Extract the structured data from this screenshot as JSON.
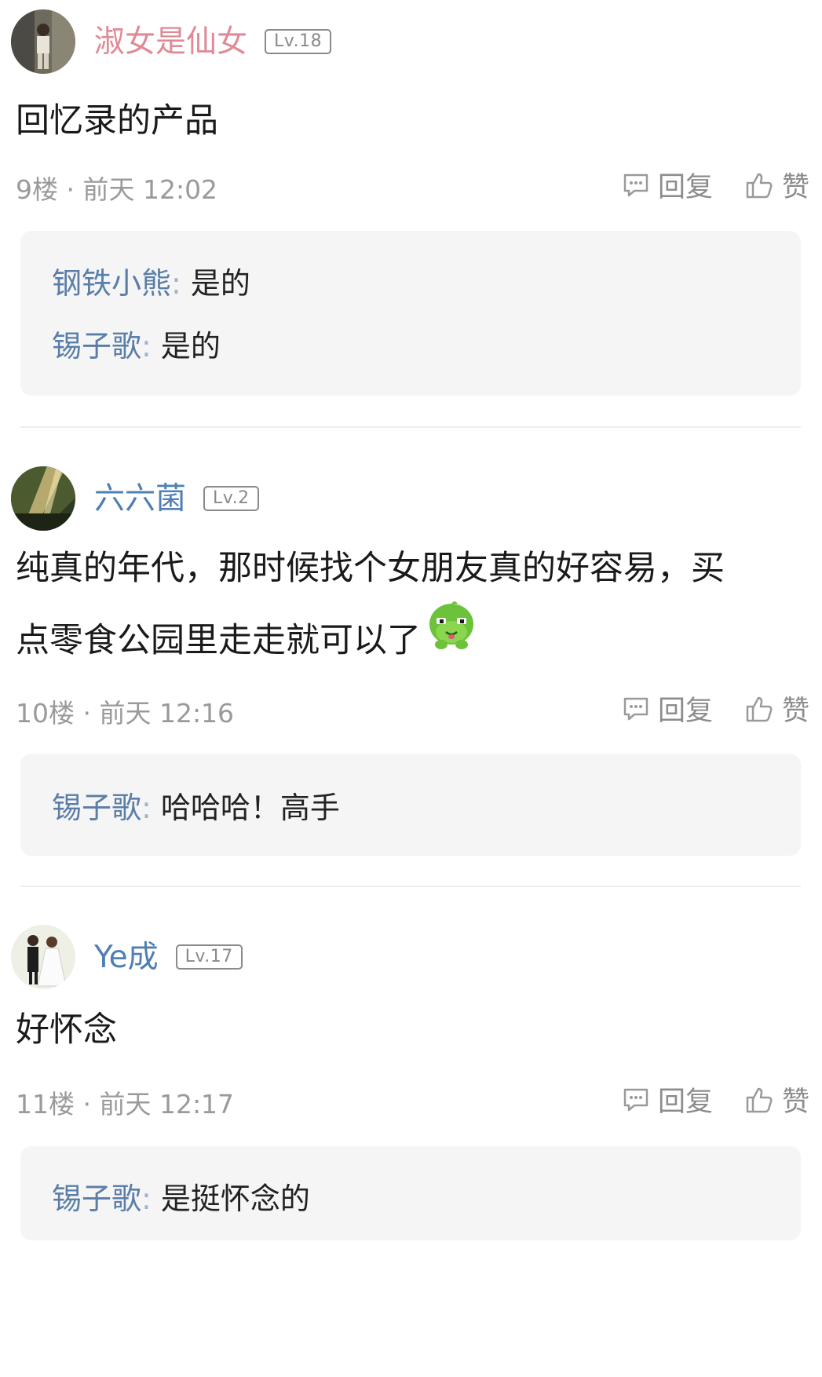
{
  "colors": {
    "username_pink": "#e08a96",
    "username_blue": "#4f7fb3",
    "reply_name": "#5a7ea8",
    "meta_gray": "#9a9a9a",
    "reply_bg": "#f5f5f5"
  },
  "labels": {
    "reply": "回复",
    "like": "赞",
    "colon": ":"
  },
  "posts": [
    {
      "username": "淑女是仙女",
      "level": "Lv.18",
      "content_lines": [
        "回忆录的产品"
      ],
      "meta": "9楼 · 前天 12:02",
      "replies": [
        {
          "name": "钢铁小熊",
          "text": "是的"
        },
        {
          "name": "锡子歌",
          "text": "是的"
        }
      ]
    },
    {
      "username": "六六菌",
      "level": "Lv.2",
      "content_lines": [
        "纯真的年代，那时候找个女朋友真的好容易，买",
        "点零食公园里走走就可以了"
      ],
      "emoji": "green-smirk-emoji",
      "meta": "10楼 · 前天 12:16",
      "replies": [
        {
          "name": "锡子歌",
          "text": "哈哈哈！高手"
        }
      ]
    },
    {
      "username": "Ye成",
      "level": "Lv.17",
      "content_lines": [
        "好怀念"
      ],
      "meta": "11楼 · 前天 12:17",
      "replies": [
        {
          "name": "锡子歌",
          "text": "是挺怀念的"
        }
      ]
    }
  ]
}
